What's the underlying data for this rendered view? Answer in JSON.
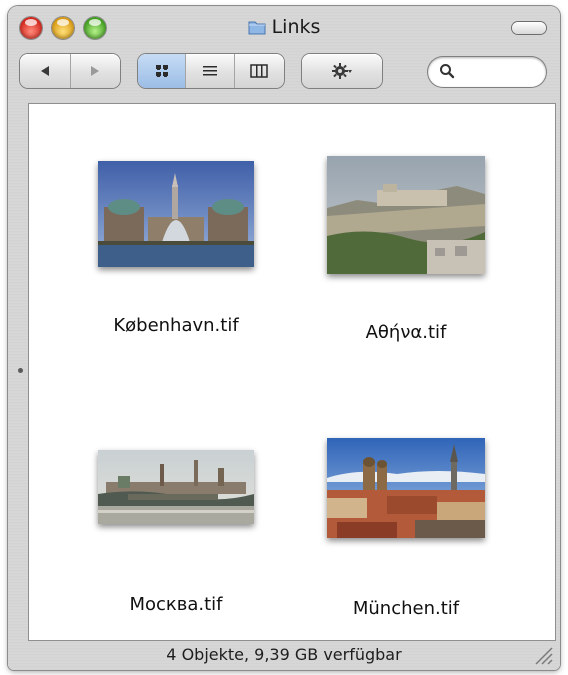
{
  "window": {
    "title": "Links",
    "title_icon": "folder-icon"
  },
  "toolbar": {
    "back": "back-arrow-icon",
    "forward": "forward-arrow-icon",
    "views": [
      "icon-view-icon",
      "list-view-icon",
      "column-view-icon"
    ],
    "selected_view": "icon-view-icon",
    "action": "gear-icon",
    "search": {
      "value": "",
      "placeholder": ""
    }
  },
  "files": [
    {
      "name": "København.tif",
      "thumbnail": "copenhagen-photo"
    },
    {
      "name": "Αθήνα.tif",
      "thumbnail": "athens-photo"
    },
    {
      "name": "Москва.tif",
      "thumbnail": "moscow-photo"
    },
    {
      "name": "München.tif",
      "thumbnail": "munich-photo"
    }
  ],
  "status": {
    "text": "4 Objekte, 9,39 GB verfügbar"
  },
  "colors": {
    "selection": "#9cbde6",
    "close": "#d3261c",
    "minimize": "#d99a12",
    "zoom": "#3f9e1f"
  }
}
